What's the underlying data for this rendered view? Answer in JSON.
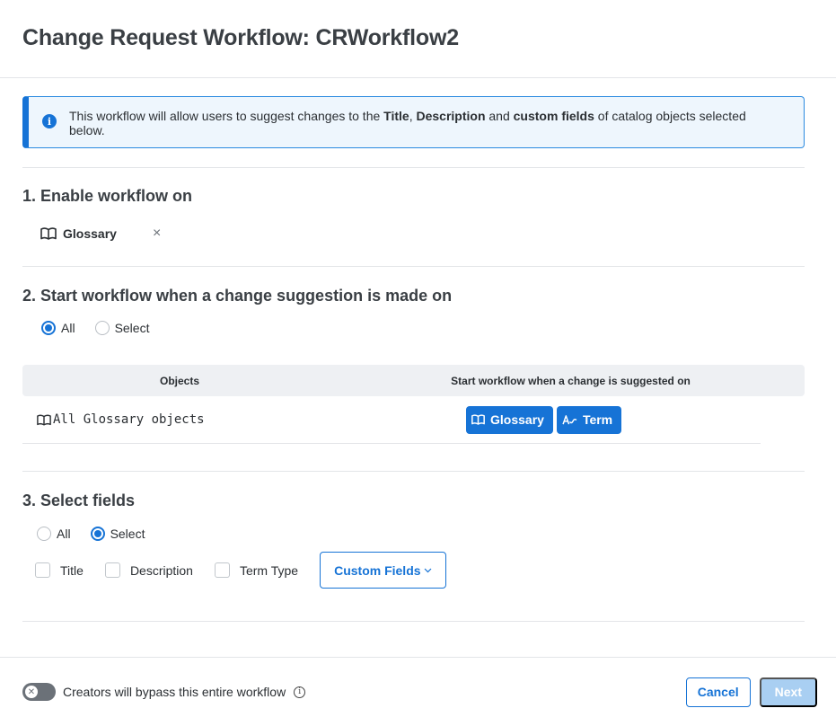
{
  "modal": {
    "title": "Change Request Workflow: CRWorkflow2"
  },
  "info": {
    "text_1": "This workflow will allow users to suggest changes to the ",
    "bold_title": "Title",
    "sep_1": ", ",
    "bold_description": "Description",
    "sep_2": " and ",
    "bold_custom": "custom fields",
    "text_2": " of catalog objects selected below.",
    "icon": "info-icon"
  },
  "section1": {
    "title": "1. Enable workflow on",
    "chip_label": "Glossary",
    "chip_icon": "book-icon",
    "remove_glyph": "×"
  },
  "section2": {
    "title": "2. Start workflow when a change suggestion is made on",
    "radio_all": "All",
    "radio_select": "Select",
    "selected": "All",
    "table": {
      "headers": [
        "Objects",
        "Start workflow when a change is suggested on"
      ],
      "rows": [
        {
          "object": "All Glossary objects",
          "pills": [
            "Glossary",
            "Term"
          ]
        }
      ]
    }
  },
  "section3": {
    "title": "3. Select fields",
    "radio_all": "All",
    "radio_select": "Select",
    "selected": "Select",
    "fields": [
      "Title",
      "Description",
      "Term Type"
    ],
    "custom_fields_button": "Custom Fields"
  },
  "footer": {
    "toggle_label": "Creators will bypass this entire workflow",
    "toggle_on": false,
    "cancel_label": "Cancel",
    "next_label": "Next"
  },
  "colors": {
    "accent": "#1673d6",
    "next_disabled": "#a9cff2",
    "info_bg": "#eef6fd"
  }
}
